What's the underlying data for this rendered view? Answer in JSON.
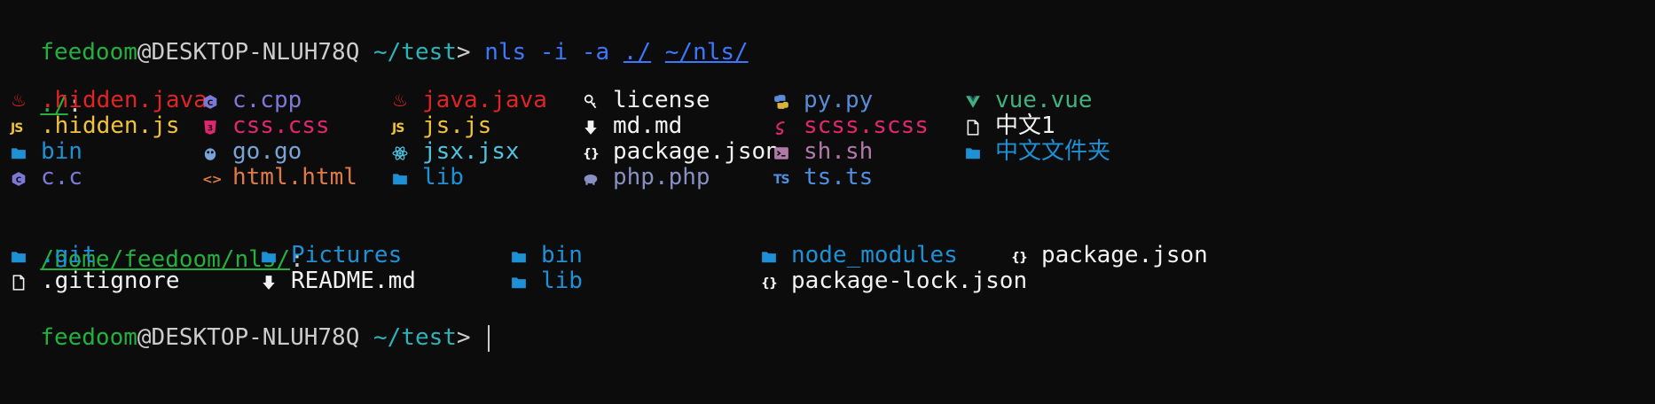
{
  "prompt": {
    "user": "feedoom",
    "host": "@DESKTOP-NLUH78Q",
    "cwd": "~/test",
    "symbol": ">",
    "colors": {
      "user": "#23b03e",
      "host": "#cccccc",
      "cwd": "#2bb3ba",
      "symbol": "#cccccc"
    }
  },
  "command": {
    "name": "nls",
    "flags": "-i -a",
    "arg1": "./",
    "arg2": "~/nls/",
    "color": "#3b78ff"
  },
  "sections": [
    {
      "header": "./",
      "header_suffix": ":",
      "entries": [
        {
          "icon": "java-icon",
          "glyph": "♨",
          "name": ".hidden.java",
          "color": "#e02424"
        },
        {
          "icon": "js-icon",
          "glyph": "JS",
          "name": ".hidden.js",
          "color": "#f0c23b"
        },
        {
          "icon": "folder-icon",
          "glyph": "folder",
          "name": "bin",
          "color": "#1e90d6"
        },
        {
          "icon": "c-icon",
          "glyph": "hex",
          "name": "c.c",
          "color": "#7c79d6"
        },
        {
          "icon": "cpp-icon",
          "glyph": "hex",
          "name": "c.cpp",
          "color": "#7c79d6"
        },
        {
          "icon": "css-icon",
          "glyph": "shield",
          "name": "css.css",
          "color": "#e0266e"
        },
        {
          "icon": "go-icon",
          "glyph": "gopher",
          "name": "go.go",
          "color": "#78a3d6"
        },
        {
          "icon": "html-icon",
          "glyph": "<>",
          "name": "html.html",
          "color": "#e07a45"
        },
        {
          "icon": "java-icon",
          "glyph": "♨",
          "name": "java.java",
          "color": "#e02424"
        },
        {
          "icon": "js-icon",
          "glyph": "JS",
          "name": "js.js",
          "color": "#f0c23b"
        },
        {
          "icon": "react-icon",
          "glyph": "atom",
          "name": "jsx.jsx",
          "color": "#4fc3e0"
        },
        {
          "icon": "folder-icon",
          "glyph": "folder",
          "name": "lib",
          "color": "#1e90d6"
        },
        {
          "icon": "license-icon",
          "glyph": "key",
          "name": "license",
          "color": "#f2f2f2"
        },
        {
          "icon": "markdown-icon",
          "glyph": "down",
          "name": "md.md",
          "color": "#f2f2f2"
        },
        {
          "icon": "json-icon",
          "glyph": "{}",
          "name": "package.json",
          "color": "#f2f2f2"
        },
        {
          "icon": "php-icon",
          "glyph": "elephant",
          "name": "php.php",
          "color": "#8a8fc2"
        },
        {
          "icon": "python-icon",
          "glyph": "snake",
          "name": "py.py",
          "color": "#5b8bd6"
        },
        {
          "icon": "sass-icon",
          "glyph": "sass",
          "name": "scss.scss",
          "color": "#e0266e"
        },
        {
          "icon": "shell-icon",
          "glyph": "term",
          "name": "sh.sh",
          "color": "#b07aa8"
        },
        {
          "icon": "typescript-icon",
          "glyph": "TS",
          "name": "ts.ts",
          "color": "#4f8fe0"
        },
        {
          "icon": "vue-icon",
          "glyph": "vue",
          "name": "vue.vue",
          "color": "#3fb27f"
        },
        {
          "icon": "file-icon",
          "glyph": "file",
          "name": "中文1",
          "color": "#f2f2f2"
        },
        {
          "icon": "folder-icon",
          "glyph": "folder",
          "name": "中文文件夹",
          "color": "#1e90d6"
        }
      ]
    },
    {
      "header": "/home/feedoom/nls/",
      "header_suffix": ":",
      "entries": [
        {
          "icon": "folder-icon",
          "glyph": "folder",
          "name": ".git",
          "color": "#1e90d6"
        },
        {
          "icon": "file-icon",
          "glyph": "file",
          "name": ".gitignore",
          "color": "#f2f2f2"
        },
        {
          "icon": "folder-icon",
          "glyph": "folder",
          "name": "Pictures",
          "color": "#1e90d6"
        },
        {
          "icon": "markdown-icon",
          "glyph": "down",
          "name": "README.md",
          "color": "#f2f2f2"
        },
        {
          "icon": "folder-icon",
          "glyph": "folder",
          "name": "bin",
          "color": "#1e90d6"
        },
        {
          "icon": "folder-icon",
          "glyph": "folder",
          "name": "lib",
          "color": "#1e90d6"
        },
        {
          "icon": "folder-icon",
          "glyph": "folder",
          "name": "node_modules",
          "color": "#1e90d6"
        },
        {
          "icon": "json-icon",
          "glyph": "{}",
          "name": "package-lock.json",
          "color": "#f2f2f2"
        },
        {
          "icon": "json-icon",
          "glyph": "{}",
          "name": "package.json",
          "color": "#f2f2f2"
        }
      ]
    }
  ],
  "header_color": "#23b03e"
}
